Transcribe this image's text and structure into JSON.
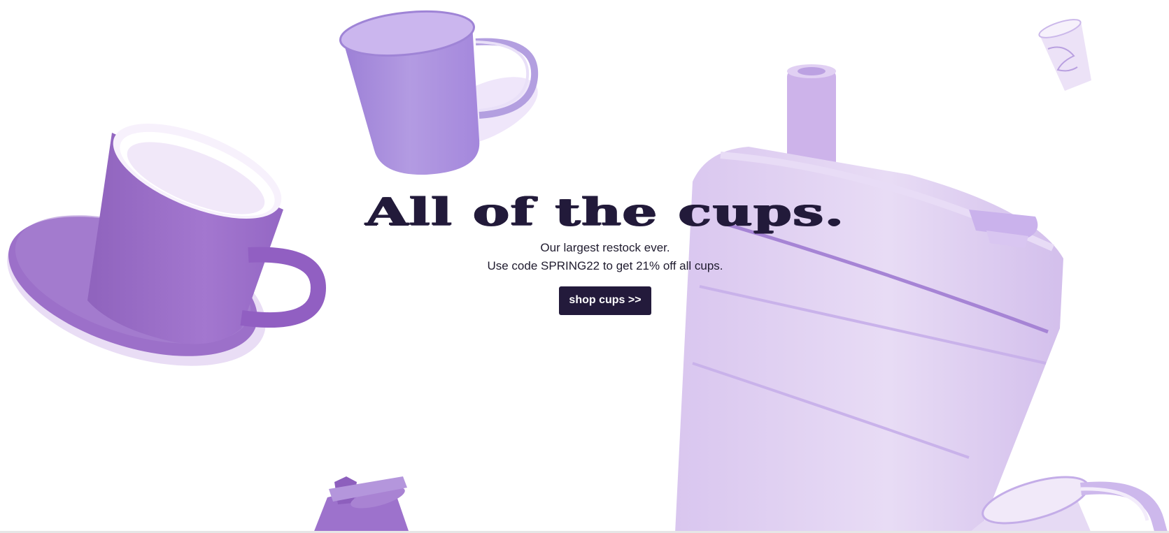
{
  "hero": {
    "headline": "All of the cups.",
    "subline_1": "Our largest restock ever.",
    "subline_2": "Use code SPRING22 to get 21% off all cups.",
    "cta_label": "shop cups >>"
  },
  "colors": {
    "headline": "#221a3a",
    "cta_background": "#231a3b",
    "cup_purple": "#a98fd8",
    "cup_lavender": "#e3d4f2",
    "background": "#ffffff"
  },
  "illustrations": [
    "teacup-with-saucer",
    "glass-mug",
    "collapsible-cup-with-straw",
    "small-paper-cup",
    "sippy-cup",
    "glass-mug-partial"
  ]
}
